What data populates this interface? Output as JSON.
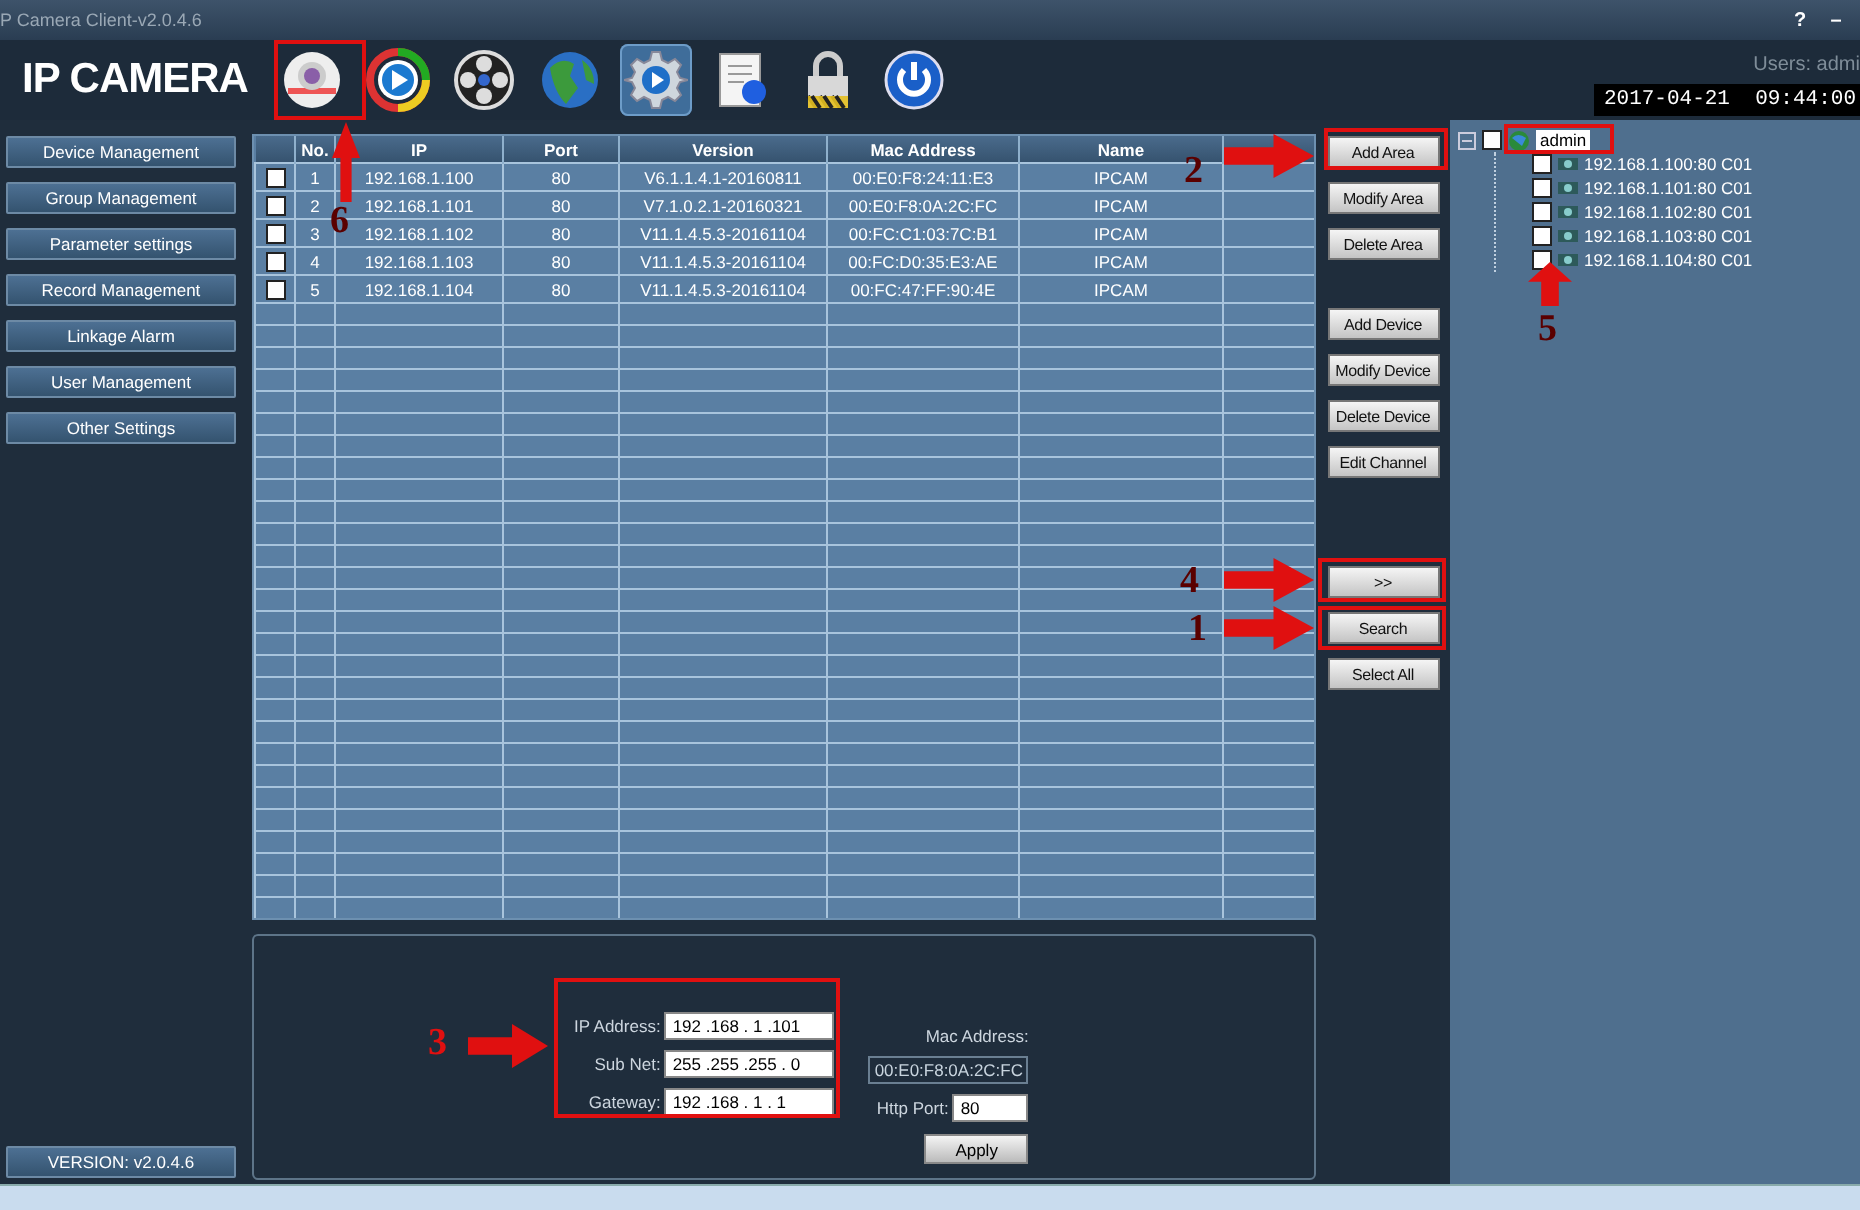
{
  "window": {
    "title": "P Camera Client-v2.0.4.6",
    "controls": [
      "?",
      "–"
    ]
  },
  "header": {
    "logo": "IP CAMERA",
    "users": "Users: admi",
    "datetime": "2017-04-21  09:44:00"
  },
  "toolbar": [
    {
      "kind": "camera",
      "selected": false
    },
    {
      "kind": "play",
      "selected": false
    },
    {
      "kind": "reel",
      "selected": false
    },
    {
      "kind": "globe",
      "selected": false
    },
    {
      "kind": "settings",
      "selected": true
    },
    {
      "kind": "document",
      "selected": false
    },
    {
      "kind": "lock",
      "selected": false
    },
    {
      "kind": "power",
      "selected": false
    }
  ],
  "sidebar": {
    "items": [
      {
        "label": "Device Management"
      },
      {
        "label": "Group Management"
      },
      {
        "label": "Parameter settings"
      },
      {
        "label": "Record Management"
      },
      {
        "label": "Linkage Alarm"
      },
      {
        "label": "User Management"
      },
      {
        "label": "Other Settings"
      }
    ],
    "version": "VERSION: v2.0.4.6"
  },
  "table": {
    "columns": [
      "No.",
      "IP",
      "Port",
      "Version",
      "Mac Address",
      "Name"
    ],
    "rows": [
      {
        "checked": false,
        "cells": [
          "1",
          "192.168.1.100",
          "80",
          "V6.1.1.4.1-20160811",
          "00:E0:F8:24:11:E3",
          "IPCAM"
        ]
      },
      {
        "checked": false,
        "cells": [
          "2",
          "192.168.1.101",
          "80",
          "V7.1.0.2.1-20160321",
          "00:E0:F8:0A:2C:FC",
          "IPCAM"
        ]
      },
      {
        "checked": false,
        "cells": [
          "3",
          "192.168.1.102",
          "80",
          "V11.1.4.5.3-20161104",
          "00:FC:C1:03:7C:B1",
          "IPCAM"
        ]
      },
      {
        "checked": false,
        "cells": [
          "4",
          "192.168.1.103",
          "80",
          "V11.1.4.5.3-20161104",
          "00:FC:D0:35:E3:AE",
          "IPCAM"
        ]
      },
      {
        "checked": false,
        "cells": [
          "5",
          "192.168.1.104",
          "80",
          "V11.1.4.5.3-20161104",
          "00:FC:47:FF:90:4E",
          "IPCAM"
        ]
      }
    ]
  },
  "action_groups": [
    [
      "Add Area",
      "Modify Area",
      "Delete Area"
    ],
    [
      "Add Device",
      "Modify Device",
      "Delete Device",
      "Edit Channel"
    ],
    [
      ">>",
      "Search",
      "Select All"
    ]
  ],
  "tree": {
    "root": {
      "label": "admin",
      "checked": false,
      "expanded": true,
      "children": [
        {
          "label": "192.168.1.100:80 C01",
          "checked": false
        },
        {
          "label": "192.168.1.101:80 C01",
          "checked": false
        },
        {
          "label": "192.168.1.102:80 C01",
          "checked": false
        },
        {
          "label": "192.168.1.103:80 C01",
          "checked": false
        },
        {
          "label": "192.168.1.104:80 C01",
          "checked": false
        }
      ]
    }
  },
  "network_form": {
    "fields": [
      {
        "label": "IP Address:",
        "value": "192 .168 . 1 .101"
      },
      {
        "label": "Sub Net:",
        "value": "255 .255 .255 . 0"
      },
      {
        "label": "Gateway:",
        "value": "192 .168 . 1 . 1"
      }
    ],
    "mac": {
      "label": "Mac Address:",
      "value": "00:E0:F8:0A:2C:FC",
      "disabled": true
    },
    "http_port": {
      "label": "Http Port:",
      "value": "80"
    },
    "apply": "Apply"
  },
  "annotations": [
    {
      "label": "6",
      "kind": "arrow-up"
    },
    {
      "label": "2",
      "kind": "arrow-right"
    },
    {
      "label": "5",
      "kind": "arrow-up"
    },
    {
      "label": "4",
      "kind": "arrow-right"
    },
    {
      "label": "1",
      "kind": "arrow-right"
    },
    {
      "label": "3",
      "kind": "arrow-right"
    }
  ]
}
